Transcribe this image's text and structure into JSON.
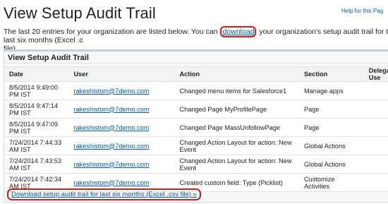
{
  "header": {
    "title": "View Setup Audit Trail",
    "help_link": "Help for this Pag"
  },
  "intro": {
    "before": "The last 20 entries for your organization are listed below. You can ",
    "link": "download",
    "after": " your organization's setup audit trail for the last six months (Excel .c",
    "line2": "file)."
  },
  "panel": {
    "title": "View Setup Audit Trail",
    "columns": [
      "Date",
      "User",
      "Action",
      "Section",
      "Delegate Use"
    ],
    "rows": [
      {
        "date": "8/5/2014 9:49:00 PM IST",
        "user": "rakeshistom@7demo.com",
        "action": "Changed menu items for Salesforce1",
        "section": "Manage apps",
        "delegate": ""
      },
      {
        "date": "8/5/2014 9:47:14 PM IST",
        "user": "rakeshistom@7demo.com",
        "action": "Changed Page MyProfilePage",
        "section": "Page",
        "delegate": ""
      },
      {
        "date": "8/5/2014 9:47:09 PM IST",
        "user": "rakeshistom@7demo.com",
        "action": "Changed Page MassUnfollowPage",
        "section": "Page",
        "delegate": ""
      },
      {
        "date": "7/24/2014 7:44:33 AM IST",
        "user": "rakeshistom@7demo.com",
        "action": "Changed Action Layout for action: New Event",
        "section": "Global Actions",
        "delegate": ""
      },
      {
        "date": "7/24/2014 7:43:53 AM IST",
        "user": "rakeshistom@7demo.com",
        "action": "Changed Action Layout for action: New Event",
        "section": "Global Actions",
        "delegate": ""
      },
      {
        "date": "7/24/2014 7:42:34 AM IST",
        "user": "rakeshistom@7demo.com",
        "action": "Created custom field: Type (Picklist)",
        "section": "Customize Activities",
        "delegate": ""
      }
    ],
    "download_link": "Download setup audit trail for last six months (Excel .csv file) »"
  },
  "colors": {
    "link": "#015ba7",
    "highlight": "#d21b1b",
    "panel_border": "#c5d2db"
  }
}
